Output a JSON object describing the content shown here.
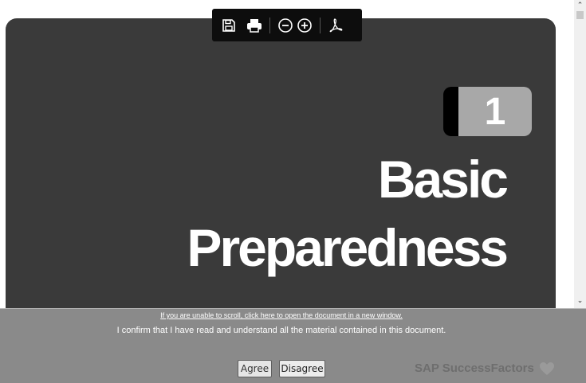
{
  "viewer": {
    "toolbar": {
      "icons": [
        "save-icon",
        "print-icon",
        "zoom-out-icon",
        "zoom-in-icon",
        "pdf-icon"
      ]
    },
    "document": {
      "chapter_number": "1",
      "title_line1": "Basic",
      "title_line2": "Preparedness"
    }
  },
  "footer": {
    "open_link": "If you are unable to scroll, click here to open the document in a new window.",
    "confirm_text": "I confirm that I have read and understand all the material contained in this document.",
    "agree_label": "Agree",
    "disagree_label": "Disagree",
    "brand": "SAP SuccessFactors"
  },
  "colors": {
    "page_background": "#3a3a3a",
    "footer_background": "#8a8a8a",
    "badge_grey": "#a8a8a8"
  }
}
